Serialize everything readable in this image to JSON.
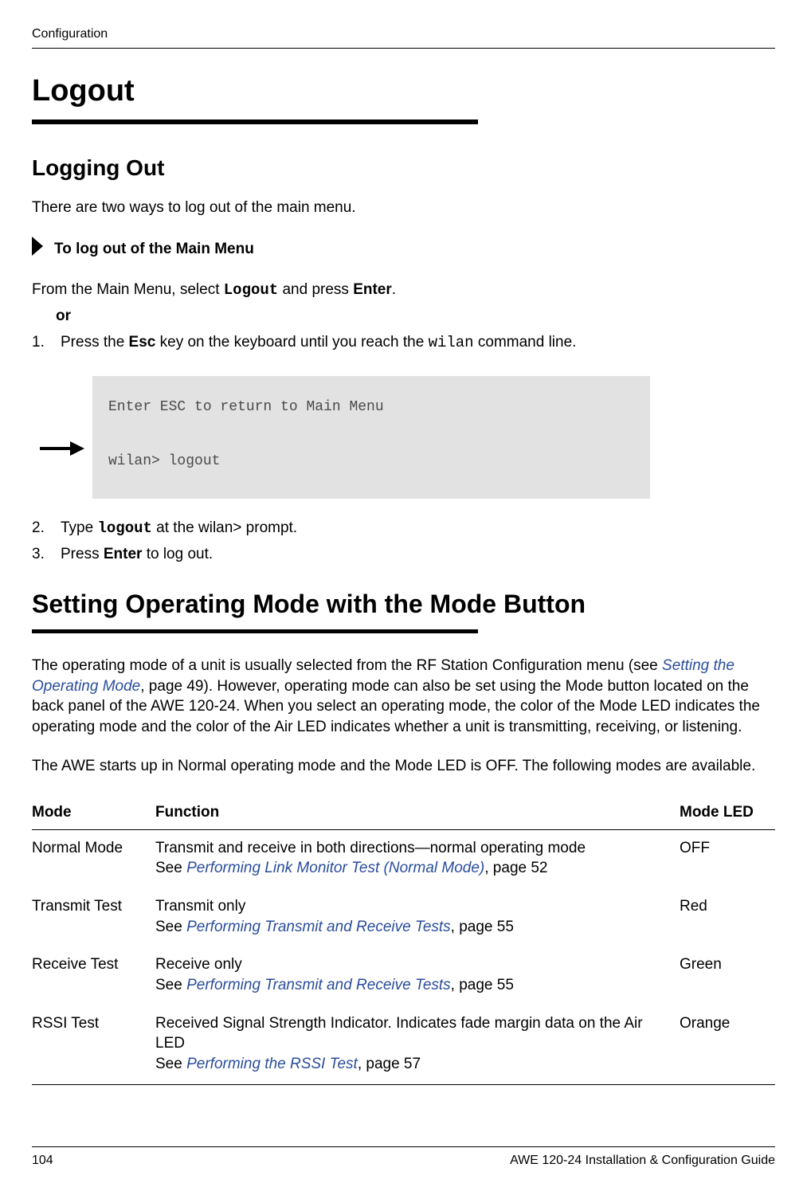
{
  "running_head": "Configuration",
  "h1_logout": "Logout",
  "h2_logging_out": "Logging Out",
  "body_intro": "There are two ways to log out of the main menu.",
  "proc_label": "To log out of the Main Menu",
  "from_main_1": "From the Main Menu, select ",
  "logout_bold": "Logout",
  "from_main_2": " and press ",
  "enter_bold": "Enter",
  "from_main_3": ".",
  "or_label": "or",
  "step1_pre": "Press the ",
  "esc_bold": "Esc",
  "step1_mid": " key on the keyboard until you reach the ",
  "wilan_mono": "wilan",
  "step1_post": " command line.",
  "code_line1": "Enter ESC to return to Main Menu",
  "code_line2": "wilan> logout",
  "step2_pre": "Type ",
  "logout_mono": "logout",
  "step2_post": " at the wilan> prompt.",
  "step3_pre": "Press ",
  "enter_bold2": "Enter",
  "step3_post": " to log out.",
  "h1_setting": "Setting Operating Mode with the Mode Button",
  "para_setting_1": "The operating mode of a unit is usually selected from the RF Station Configuration menu (see ",
  "link_setting_mode": "Setting the Operating Mode",
  "para_setting_2": ", page 49). However, operating mode can also be set using the Mode button located on the back panel of the AWE 120-24. When you select an operating mode, the color of the Mode LED indicates the operating mode and the color of the Air LED indicates whether a unit is transmitting, receiving, or listening.",
  "para_awe_starts": "The AWE starts up in Normal operating mode and the Mode LED is OFF. The following modes are available.",
  "table": {
    "headers": {
      "mode": "Mode",
      "function": "Function",
      "led": "Mode LED"
    },
    "rows": [
      {
        "mode": "Normal Mode",
        "func_line1": "Transmit and receive in both directions—normal operating mode",
        "func_see": "See ",
        "func_link": "Performing Link Monitor Test (Normal Mode)",
        "func_page": ", page 52",
        "led": "OFF"
      },
      {
        "mode": "Transmit Test",
        "func_line1": "Transmit only",
        "func_see": "See ",
        "func_link": "Performing Transmit and Receive Tests",
        "func_page": ", page 55",
        "led": "Red"
      },
      {
        "mode": "Receive Test",
        "func_line1": "Receive only",
        "func_see": "See ",
        "func_link": "Performing Transmit and Receive Tests",
        "func_page": ", page 55",
        "led": "Green"
      },
      {
        "mode": "RSSI Test",
        "func_line1": "Received Signal Strength Indicator. Indicates fade margin data on the Air LED",
        "func_see": "See ",
        "func_link": "Performing the RSSI Test",
        "func_page": ", page 57",
        "led": "Orange"
      }
    ]
  },
  "footer": {
    "page": "104",
    "guide": "AWE 120-24 Installation & Configuration Guide"
  }
}
